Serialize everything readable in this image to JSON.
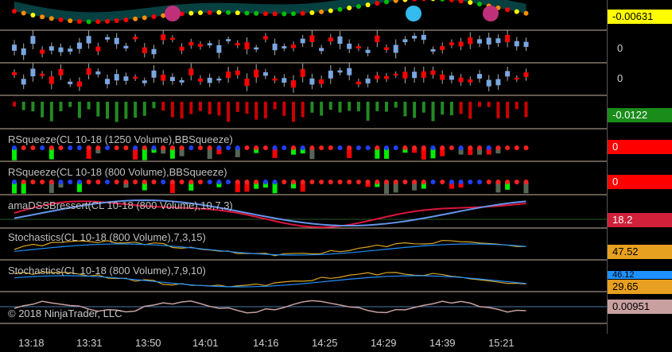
{
  "panels": [
    {
      "label": "",
      "value": "-0.00631",
      "value_bg": "#ffff00",
      "value_color": "#000000"
    },
    {
      "label": "",
      "value": "0"
    },
    {
      "label": "",
      "value": "0"
    },
    {
      "label": "",
      "value": "-0.0122",
      "value_bg": "#1a8c1a",
      "value_color": "#ffffff"
    },
    {
      "label": "RSqueeze(CL 10-18 (1250 Volume),BBSqueeze)",
      "value": "0",
      "value_bg": "#ff0000",
      "value_color": "#ffffff"
    },
    {
      "label": "RSqueeze(CL 10-18 (800 Volume),BBSqueeze)",
      "value": "0",
      "value_bg": "#ff0000",
      "value_color": "#ffffff"
    },
    {
      "label": "amaDSSBressert(CL 10-18 (800 Volume),10,7,3)",
      "value": "18.2",
      "value_bg": "#d0203a",
      "value_color": "#ffffff"
    },
    {
      "label": "Stochastics(CL 10-18 (800 Volume),7,3,15)",
      "value": "47.52",
      "value_bg": "#e8a020",
      "value_color": "#000000"
    },
    {
      "label": "Stochastics(CL 10-18 (800 Volume),7,9,10)",
      "value": "29.65",
      "value_bg": "#e8a020",
      "value_color": "#000000",
      "value2": "46.12"
    },
    {
      "label": "",
      "value": "0.00951",
      "value_bg": "#c8a0a0",
      "value_color": "#000000"
    }
  ],
  "copyright": "© 2018 NinjaTrader, LLC",
  "time_axis": [
    "13:18",
    "13:31",
    "13:50",
    "14:01",
    "14:16",
    "14:25",
    "14:29",
    "14:39",
    "15:21"
  ],
  "colors": {
    "up": "#7aa7e0",
    "down": "#ff0000",
    "hist_up": "#228b22",
    "hist_down": "#cc0000",
    "dss": "#dc143c",
    "dss_signal": "#6495ed",
    "stoch_k": "#daa520",
    "stoch_d": "#1e90ff",
    "separator": "#c8b4a0"
  }
}
